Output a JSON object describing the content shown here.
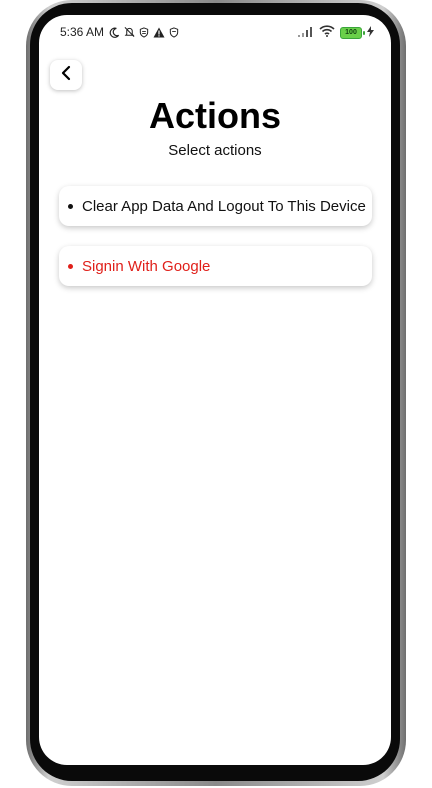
{
  "status_bar": {
    "time": "5:36 AM",
    "battery_level": "100",
    "left_icons": [
      "moon-icon",
      "bell-off-icon",
      "shield-icon",
      "warning-icon",
      "shield-icon"
    ],
    "right_icons": [
      "signal-icon",
      "wifi-icon",
      "battery-icon",
      "charging-icon"
    ]
  },
  "header": {
    "title": "Actions",
    "subtitle": "Select actions"
  },
  "actions": [
    {
      "label": "Clear App Data And Logout To This Device",
      "color": "#111111"
    },
    {
      "label": "Signin With Google",
      "color": "#e0201a"
    }
  ],
  "colors": {
    "accent_red": "#e0201a",
    "text_dark": "#111111",
    "frame": "#0a0a0a"
  }
}
